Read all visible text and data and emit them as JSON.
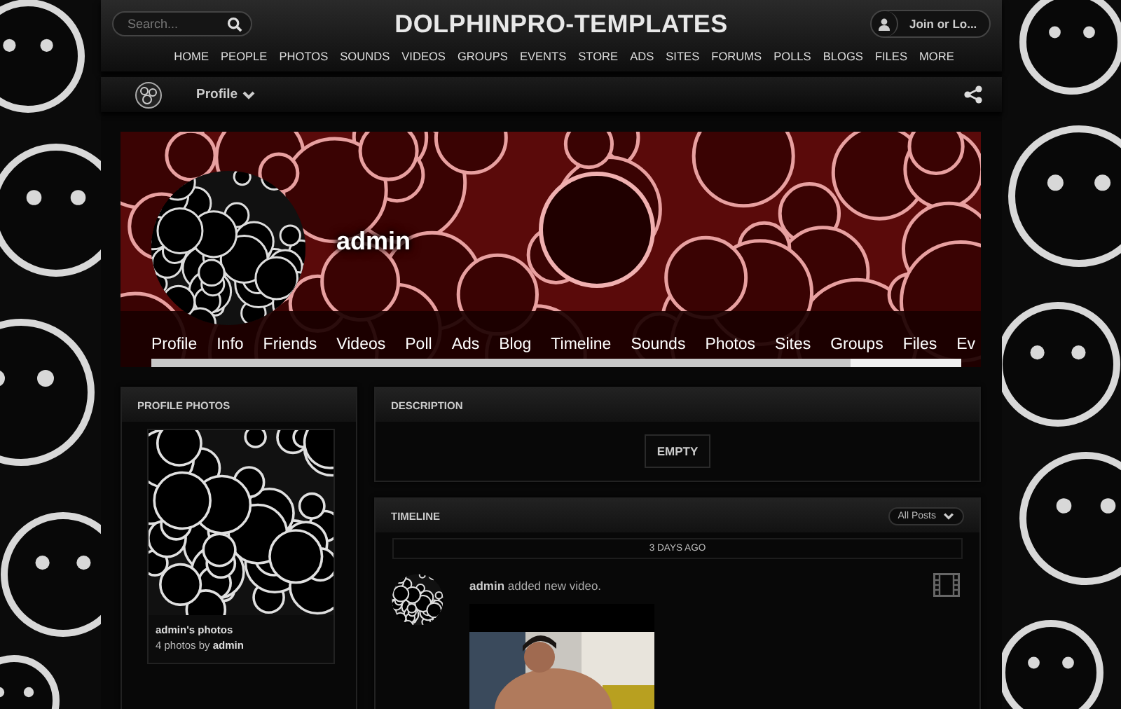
{
  "header": {
    "search": {
      "placeholder": "Search..."
    },
    "site_title": "DOLPHINPRO-TEMPLATES",
    "join_button": "Join or Lo..."
  },
  "nav": [
    "HOME",
    "PEOPLE",
    "PHOTOS",
    "SOUNDS",
    "VIDEOS",
    "GROUPS",
    "EVENTS",
    "STORE",
    "ADS",
    "SITES",
    "FORUMS",
    "POLLS",
    "BLOGS",
    "FILES",
    "MORE"
  ],
  "sub_bar": {
    "menu": "Profile"
  },
  "cover": {
    "kind": "picture",
    "name": "admin",
    "tabs": [
      "Profile",
      "Info",
      "Friends",
      "Videos",
      "Poll",
      "Ads",
      "Blog",
      "Timeline",
      "Sounds",
      "Photos",
      "Sites",
      "Groups",
      "Files",
      "Ev"
    ]
  },
  "profile_photos": {
    "title": "PROFILE PHOTOS",
    "album_title": "admin's photos",
    "count_text": "4 photos by",
    "author": "admin"
  },
  "description": {
    "title": "DESCRIPTION",
    "value": "EMPTY"
  },
  "timeline": {
    "title": "TIMELINE",
    "filter": "All Posts",
    "date_divider": "3 DAYS AGO",
    "post": {
      "author": "admin",
      "action": "added new video."
    }
  }
}
